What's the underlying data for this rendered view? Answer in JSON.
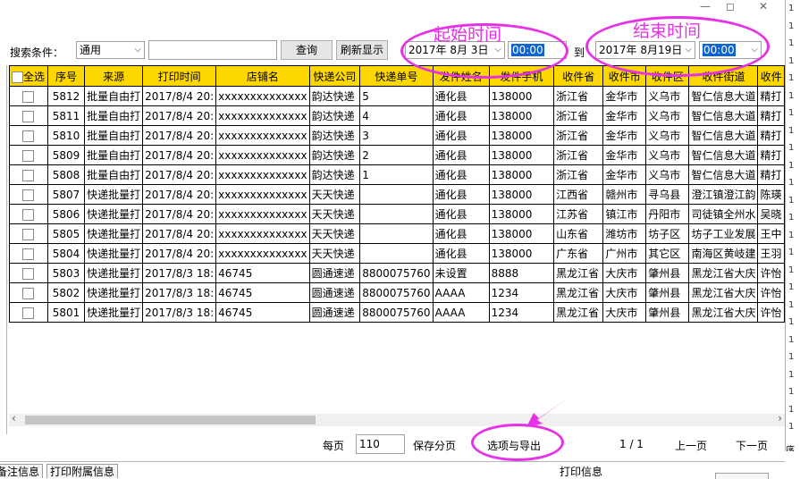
{
  "window": {
    "minimize": "—",
    "restore": "◻",
    "close": "✕"
  },
  "right_strip": {
    "lines": [
      "1",
      "1",
      "1",
      "1",
      "1",
      "1",
      "1",
      "1",
      "1",
      "1",
      "1",
      "1",
      "1",
      "1",
      "1",
      "1",
      "1",
      "1",
      "1",
      "1",
      "1",
      "1",
      "1",
      "1",
      "1"
    ],
    "bottom": "序"
  },
  "search": {
    "label": "搜索条件：",
    "type_value": "通用",
    "keyword_value": "",
    "query_button": "查询",
    "refresh_button": "刷新显示",
    "start_date": "2017年  8月  3日",
    "start_time": "00:00",
    "to_label": "到",
    "end_date": "2017年  8月19日",
    "end_time": "00:00"
  },
  "annotations": {
    "start_time_label": "起始时间",
    "end_time_label": "结束时间",
    "color": "#e632e6"
  },
  "table": {
    "columns": [
      "全选",
      "序号",
      "来源",
      "打印时间",
      "店铺名",
      "快递公司",
      "快递单号",
      "发件姓名",
      "发件手机",
      "收件省",
      "收件市",
      "收件区",
      "收件街道",
      "收件"
    ],
    "rows": [
      [
        "",
        "5812",
        "批量自由打",
        "2017/8/4 20:",
        "xxxxxxxxxxxxxx",
        "韵达快递",
        "5",
        "通化县",
        "138000",
        "浙江省",
        "金华市",
        "义乌市",
        "智仁信息大道",
        "精打"
      ],
      [
        "",
        "5811",
        "批量自由打",
        "2017/8/4 20:",
        "xxxxxxxxxxxxxx",
        "韵达快递",
        "4",
        "通化县",
        "138000",
        "浙江省",
        "金华市",
        "义乌市",
        "智仁信息大道",
        "精打"
      ],
      [
        "",
        "5810",
        "批量自由打",
        "2017/8/4 20:",
        "xxxxxxxxxxxxxx",
        "韵达快递",
        "3",
        "通化县",
        "138000",
        "浙江省",
        "金华市",
        "义乌市",
        "智仁信息大道",
        "精打"
      ],
      [
        "",
        "5809",
        "批量自由打",
        "2017/8/4 20:",
        "xxxxxxxxxxxxxx",
        "韵达快递",
        "2",
        "通化县",
        "138000",
        "浙江省",
        "金华市",
        "义乌市",
        "智仁信息大道",
        "精打"
      ],
      [
        "",
        "5808",
        "批量自由打",
        "2017/8/4 20:",
        "xxxxxxxxxxxxxx",
        "韵达快递",
        "1",
        "通化县",
        "138000",
        "浙江省",
        "金华市",
        "义乌市",
        "智仁信息大道",
        "精打"
      ],
      [
        "",
        "5807",
        "快递批量打",
        "2017/8/4 20:",
        "xxxxxxxxxxxxxx",
        "天天快递",
        "",
        "通化县",
        "138000",
        "江西省",
        "赣州市",
        "寻乌县",
        "澄江镇澄江韵",
        "陈瑛"
      ],
      [
        "",
        "5806",
        "快递批量打",
        "2017/8/4 20:",
        "xxxxxxxxxxxxxx",
        "天天快递",
        "",
        "通化县",
        "138000",
        "江苏省",
        "镇江市",
        "丹阳市",
        "司徒镇全州水",
        "吴晓"
      ],
      [
        "",
        "5805",
        "快递批量打",
        "2017/8/4 20:",
        "xxxxxxxxxxxxxx",
        "天天快递",
        "",
        "通化县",
        "138000",
        "山东省",
        "潍坊市",
        "坊子区",
        "坊子工业发展",
        "王中"
      ],
      [
        "",
        "5804",
        "快递批量打",
        "2017/8/4 20:",
        "xxxxxxxxxxxxxx",
        "天天快递",
        "",
        "通化县",
        "138000",
        "广东省",
        "广州市",
        "其它区",
        "南海区黄岐建",
        "王羽"
      ],
      [
        "",
        "5803",
        "快递批量打",
        "2017/8/3 18:",
        "46745",
        "圆通速递",
        "8800075760",
        "未设置",
        "8888",
        "黑龙江省",
        "大庆市",
        "肇州县",
        "黑龙江省大庆",
        "许怡"
      ],
      [
        "",
        "5802",
        "快递批量打",
        "2017/8/3 18:",
        "46745",
        "圆通速递",
        "8800075760",
        "AAAA",
        "1234",
        "黑龙江省",
        "大庆市",
        "肇州县",
        "黑龙江省大庆",
        "许怡"
      ],
      [
        "",
        "5801",
        "快递批量打",
        "2017/8/3 18:",
        "46745",
        "圆通速递",
        "8800075760",
        "AAAA",
        "1234",
        "黑龙江省",
        "大庆市",
        "肇州县",
        "黑龙江省大庆",
        "许怡"
      ]
    ]
  },
  "pager": {
    "per_page_label": "每页",
    "per_page_value": "110",
    "save_paging": "保存分页",
    "options_export": "选项与导出",
    "page_info": "1 / 1",
    "prev": "上一页",
    "next": "下一页"
  },
  "bottom_tabs": {
    "remarks": "备注信息",
    "print_attach": "打印附属信息",
    "print_info": "打印信息"
  },
  "scroll": {
    "left_arrow": "‹",
    "right_arrow": "›"
  },
  "dropdown_arrow": "⌵"
}
